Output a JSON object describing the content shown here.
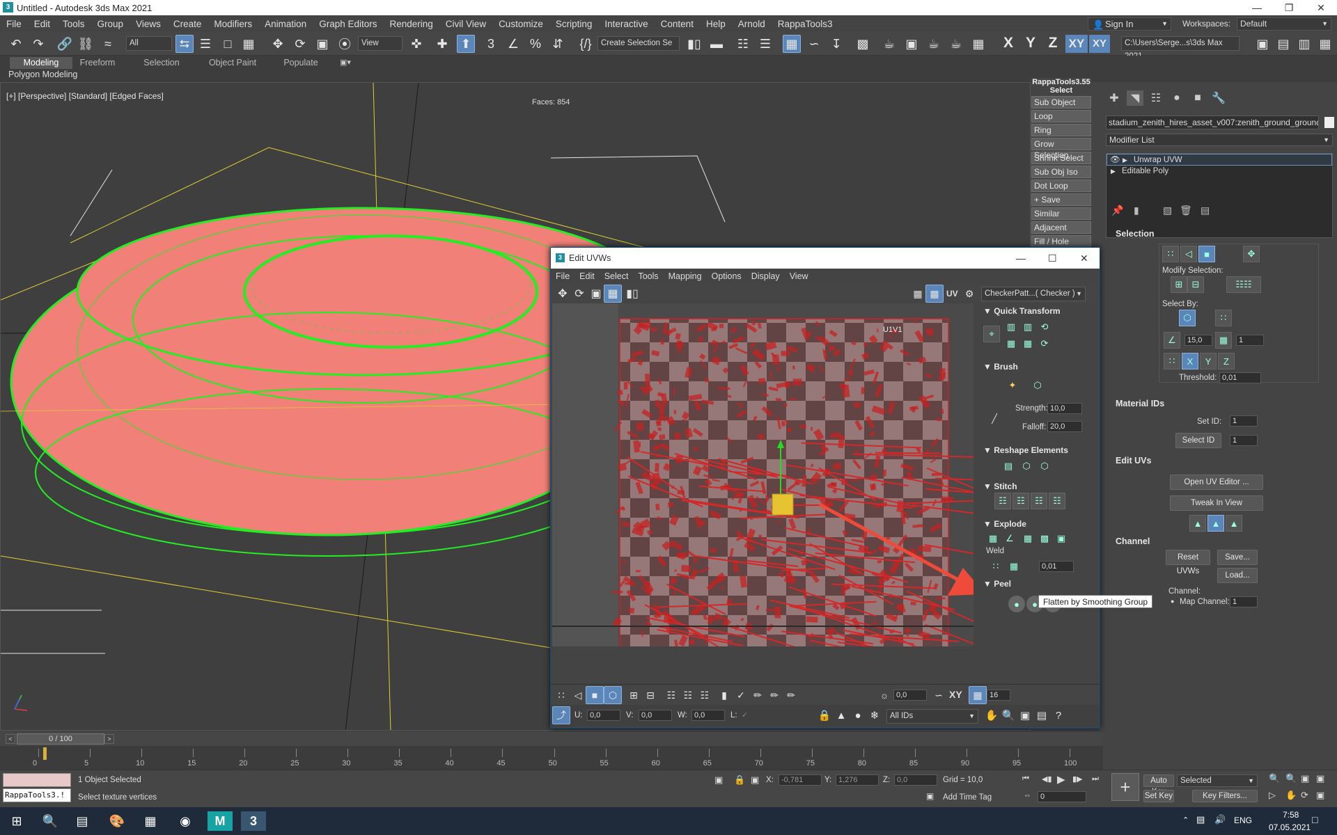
{
  "app": {
    "title": "Untitled - Autodesk 3ds Max 2021",
    "menu": [
      "File",
      "Edit",
      "Tools",
      "Group",
      "Views",
      "Create",
      "Modifiers",
      "Animation",
      "Graph Editors",
      "Rendering",
      "Civil View",
      "Customize",
      "Scripting",
      "Interactive",
      "Content",
      "Help",
      "Arnold",
      "RappaTools3"
    ],
    "sign_in": "Sign In",
    "workspaces_label": "Workspaces:",
    "workspaces_value": "Default"
  },
  "toolbar": {
    "filter_value": "All",
    "ref_coord_value": "View",
    "selection_set_value": "Create Selection Se",
    "axis_x": "X",
    "axis_y": "Y",
    "axis_z": "Z",
    "axis_xy": "XY",
    "axis_xy2": "XY",
    "project_path": "C:\\Users\\Serge...s\\3ds Max 2021"
  },
  "ribbon": {
    "tabs": [
      "Modeling",
      "Freeform",
      "Selection",
      "Object Paint",
      "Populate"
    ],
    "active_tab": "Modeling",
    "sub_label": "Polygon Modeling"
  },
  "viewport": {
    "label": "[+] [Perspective] [Standard] [Edged Faces]",
    "faces": "Faces: 854",
    "mesh_color": "#f08078",
    "edge_color": "#22ee22",
    "bbox_color": "#e0d030"
  },
  "rappatools": {
    "title": "RappaTools3.55",
    "subtitle": "Select",
    "buttons": [
      "Sub Object",
      "Loop",
      "Ring",
      "Grow Selection",
      "Shrink Select",
      "Sub Obj Iso",
      "Dot Loop",
      "+ Save",
      "Similar",
      "Adjacent",
      "Fill / Hole"
    ]
  },
  "command_panel": {
    "object_name": "stadium_zenith_hires_asset_v007:zenith_ground_ground_M_s",
    "modifier_list": "Modifier List",
    "stack": [
      "Unwrap UVW",
      "Editable Poly"
    ],
    "selection": {
      "title": "Selection",
      "modify_selection": "Modify Selection:",
      "select_by": "Select By:",
      "angle": "15,0",
      "count": "1",
      "threshold_label": "Threshold:",
      "threshold": "0,01"
    },
    "material_ids": {
      "title": "Material IDs",
      "set_id_label": "Set ID:",
      "set_id": "1",
      "select_id": "Select ID",
      "select_id_value": "1"
    },
    "edit_uvs": {
      "title": "Edit UVs",
      "open_editor": "Open UV Editor ...",
      "tweak": "Tweak In View"
    },
    "channel": {
      "title": "Channel",
      "reset": "Reset UVWs",
      "save": "Save...",
      "load": "Load...",
      "channel_label": "Channel:",
      "map_channel_label": "Map Channel:",
      "map_channel": "1"
    }
  },
  "uv_editor": {
    "title": "Edit UVWs",
    "menu": [
      "File",
      "Edit",
      "Select",
      "Tools",
      "Mapping",
      "Options",
      "Display",
      "View"
    ],
    "uv_label": "UV",
    "texture": "CheckerPatt...( Checker )",
    "tile_label": "U1V1",
    "rollouts": {
      "quick_transform": "Quick Transform",
      "brush": "Brush",
      "strength_label": "Strength:",
      "strength": "10,0",
      "falloff_label": "Falloff:",
      "falloff": "20,0",
      "reshape": "Reshape Elements",
      "stitch": "Stitch",
      "explode": "Explode",
      "weld": "Weld",
      "weld_threshold": "0,01",
      "peel": "Peel"
    },
    "bottom": {
      "angle": "0,0",
      "xy": "XY",
      "grid": "16",
      "u_label": "U:",
      "u": "0,0",
      "v_label": "V:",
      "v": "0,0",
      "w_label": "W:",
      "w": "0,0",
      "l_label": "L:",
      "ids": "All IDs"
    },
    "tooltip": "Flatten by Smoothing Group"
  },
  "timeline": {
    "frame": "0 / 100",
    "ticks": [
      "0",
      "5",
      "10",
      "15",
      "20",
      "25",
      "30",
      "35",
      "40",
      "45",
      "50",
      "55",
      "60",
      "65",
      "70",
      "75",
      "80",
      "85",
      "90",
      "95",
      "100"
    ]
  },
  "status": {
    "script_field": "RappaTools3.!",
    "selected": "1 Object Selected",
    "prompt": "Select texture vertices",
    "x_label": "X:",
    "x": "-0,781",
    "y_label": "Y:",
    "y": "1,276",
    "z_label": "Z:",
    "z": "0,0",
    "grid": "Grid = 10,0",
    "add_time_tag": "Add Time Tag",
    "auto_key": "Auto Key",
    "set_key": "Set Key",
    "key_mode": "Selected",
    "key_filters": "Key Filters...",
    "frame_value": "0"
  },
  "taskbar": {
    "lang": "ENG",
    "time": "7:58",
    "date": "07.05.2021"
  }
}
